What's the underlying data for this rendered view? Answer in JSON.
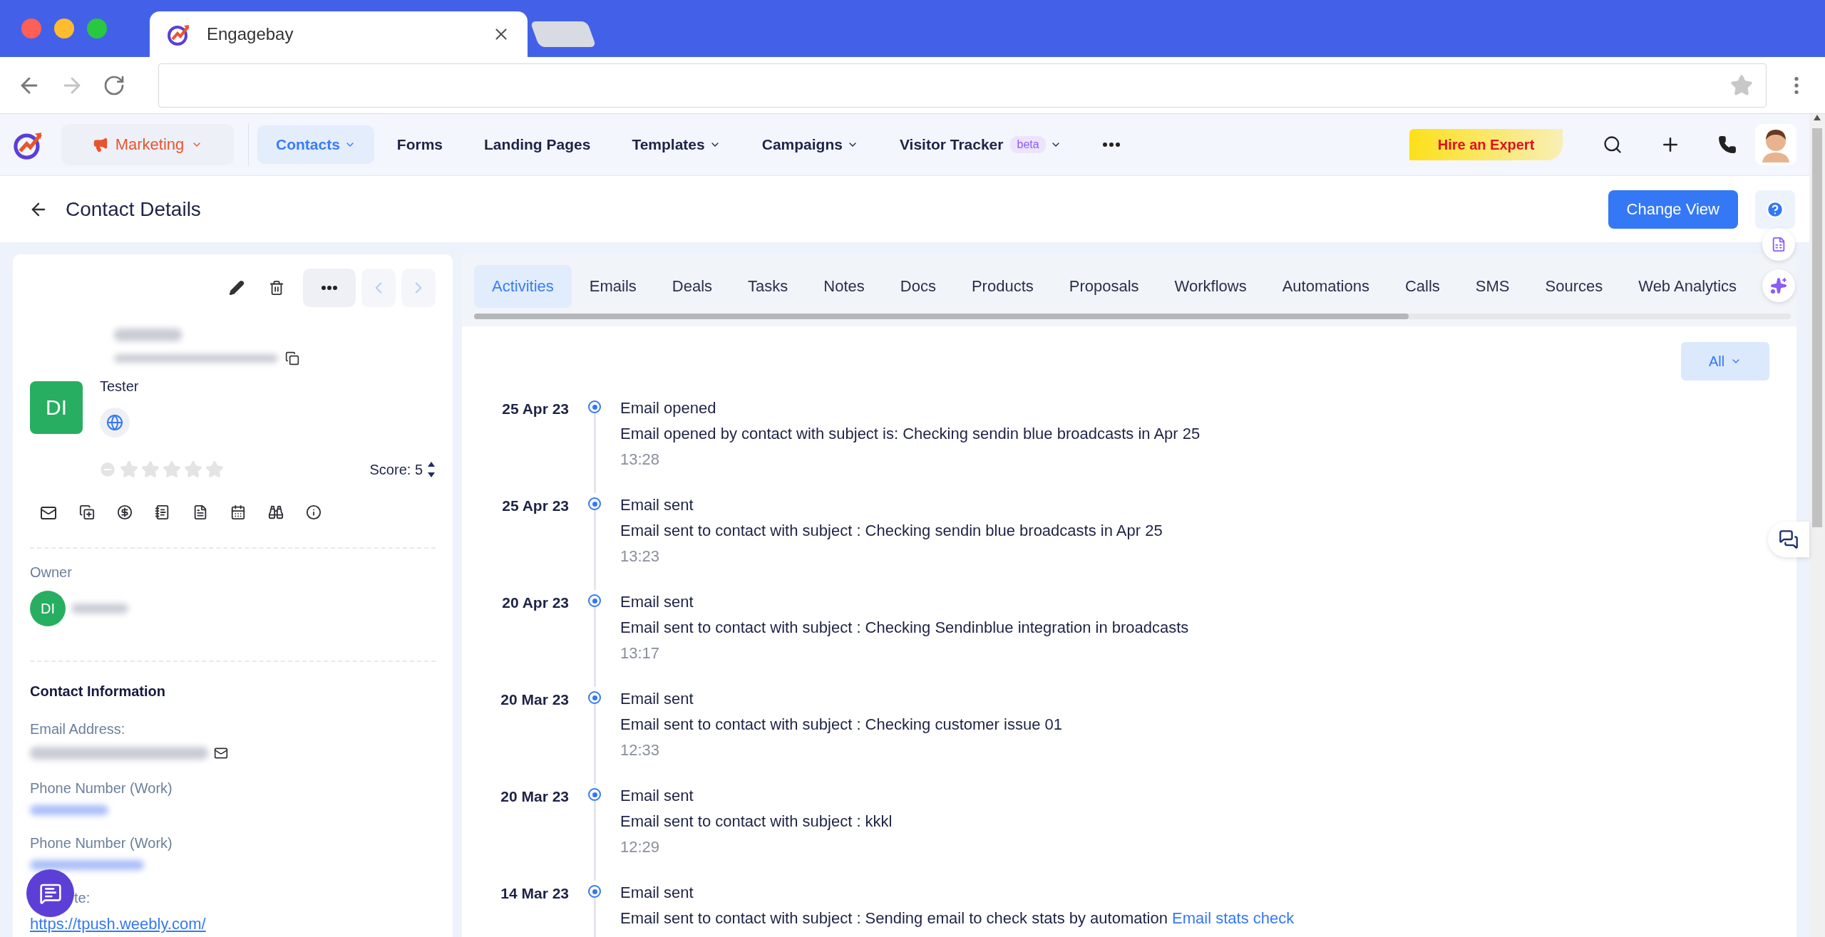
{
  "browser": {
    "tab_title": "Engagebay"
  },
  "nav": {
    "module": "Marketing",
    "items": [
      {
        "label": "Contacts",
        "selected": true,
        "dropdown": true
      },
      {
        "label": "Forms",
        "selected": false,
        "dropdown": false
      },
      {
        "label": "Landing Pages",
        "selected": false,
        "dropdown": false
      },
      {
        "label": "Templates",
        "selected": false,
        "dropdown": true
      },
      {
        "label": "Campaigns",
        "selected": false,
        "dropdown": true
      },
      {
        "label": "Visitor Tracker",
        "selected": false,
        "dropdown": true,
        "badge": "beta"
      }
    ],
    "hire_button": "Hire an Expert"
  },
  "header": {
    "title": "Contact Details",
    "button": "Change View"
  },
  "contact": {
    "initials": "DI",
    "job_title": "Tester",
    "stars": 0,
    "score": "Score: 5",
    "owner_label": "Owner",
    "owner_initials": "DI",
    "section_title": "Contact Information",
    "fields": [
      {
        "label": "Email Address:",
        "kind": "email"
      },
      {
        "label": "Phone Number (Work)",
        "kind": "phone"
      },
      {
        "label": "Phone Number (Work)",
        "kind": "phone"
      },
      {
        "label": "te:",
        "kind": "link",
        "value": "https://tpush.weebly.com/"
      }
    ]
  },
  "tabs": [
    {
      "label": "Activities",
      "selected": true
    },
    {
      "label": "Emails",
      "selected": false
    },
    {
      "label": "Deals",
      "selected": false
    },
    {
      "label": "Tasks",
      "selected": false
    },
    {
      "label": "Notes",
      "selected": false
    },
    {
      "label": "Docs",
      "selected": false
    },
    {
      "label": "Products",
      "selected": false
    },
    {
      "label": "Proposals",
      "selected": false
    },
    {
      "label": "Workflows",
      "selected": false
    },
    {
      "label": "Automations",
      "selected": false
    },
    {
      "label": "Calls",
      "selected": false
    },
    {
      "label": "SMS",
      "selected": false
    },
    {
      "label": "Sources",
      "selected": false
    },
    {
      "label": "Web Analytics",
      "selected": false
    }
  ],
  "filter": "All",
  "activities": [
    {
      "date": "25 Apr 23",
      "title": "Email opened",
      "description": "Email opened by contact with subject is: Checking sendin blue broadcasts in Apr 25",
      "time": "13:28"
    },
    {
      "date": "25 Apr 23",
      "title": "Email sent",
      "description": "Email sent to contact with subject : Checking sendin blue broadcasts in Apr 25",
      "time": "13:23"
    },
    {
      "date": "20 Apr 23",
      "title": "Email sent",
      "description": "Email sent to contact with subject : Checking Sendinblue integration in broadcasts",
      "time": "13:17"
    },
    {
      "date": "20 Mar 23",
      "title": "Email sent",
      "description": "Email sent to contact with subject : Checking customer issue 01",
      "time": "12:33"
    },
    {
      "date": "20 Mar 23",
      "title": "Email sent",
      "description": "Email sent to contact with subject : kkkl",
      "time": "12:29"
    },
    {
      "date": "14 Mar 23",
      "title": "Email sent",
      "description": "Email sent to contact with subject : Sending email to check stats by automation",
      "link": "Email stats check"
    }
  ]
}
